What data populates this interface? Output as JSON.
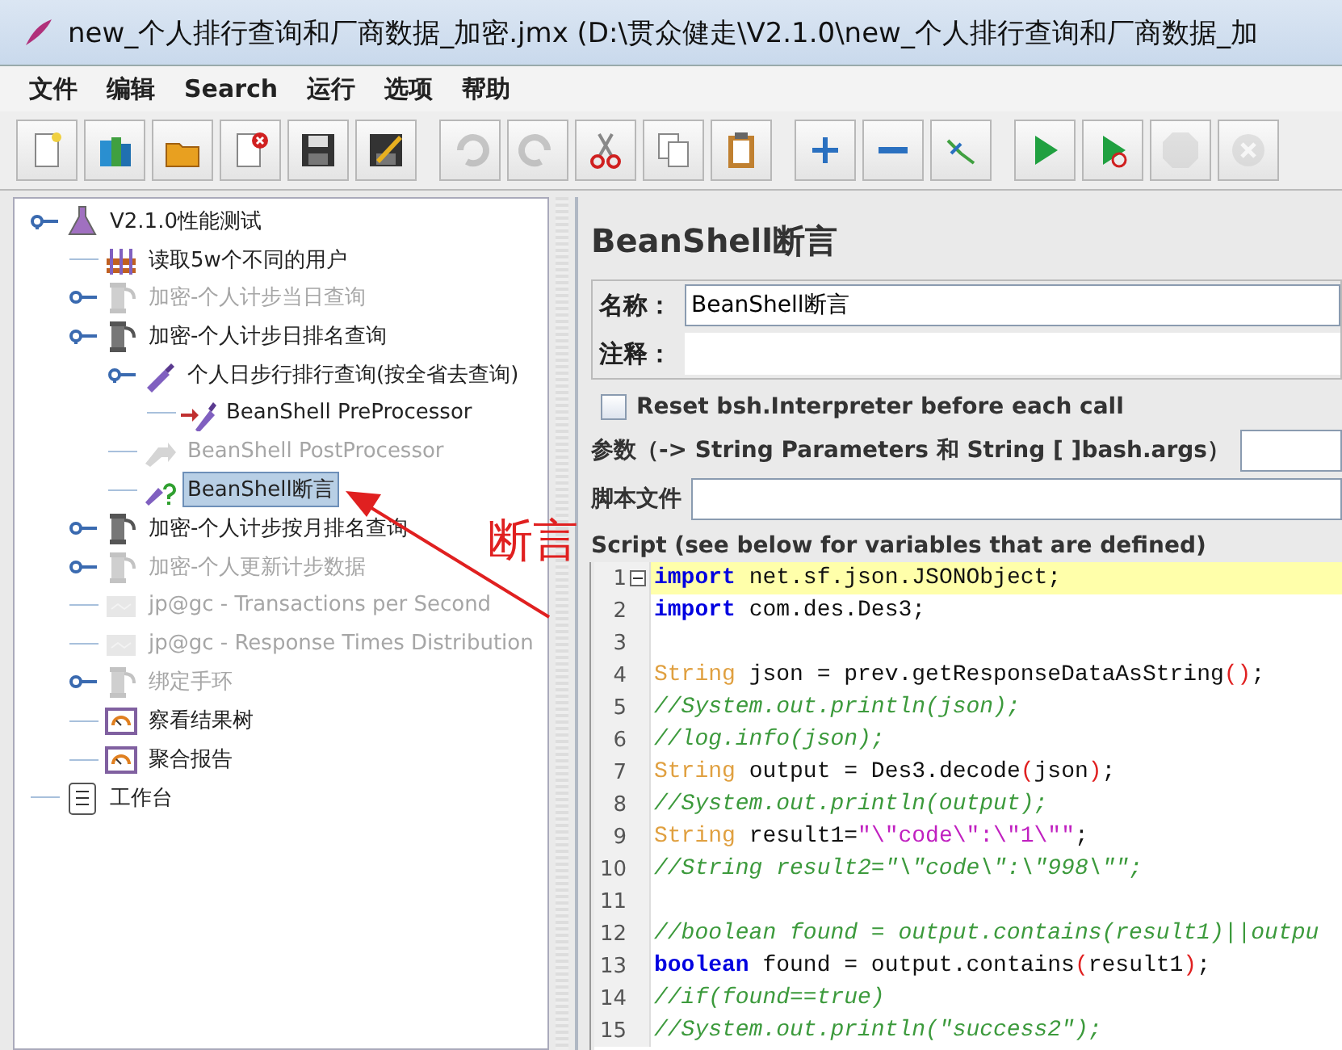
{
  "window": {
    "title": "new_个人排行查询和厂商数据_加密.jmx (D:\\贯众健走\\V2.1.0\\new_个人排行查询和厂商数据_加"
  },
  "menu": [
    "文件",
    "编辑",
    "Search",
    "运行",
    "选项",
    "帮助"
  ],
  "toolbar": [
    [
      {
        "kind": "new",
        "disabled": false
      },
      {
        "kind": "templates",
        "disabled": false
      },
      {
        "kind": "open",
        "disabled": false
      },
      {
        "kind": "close",
        "disabled": false
      },
      {
        "kind": "save",
        "disabled": false
      },
      {
        "kind": "save-as",
        "disabled": false
      }
    ],
    [
      {
        "kind": "undo",
        "disabled": true
      },
      {
        "kind": "redo",
        "disabled": true
      },
      {
        "kind": "cut",
        "disabled": false
      },
      {
        "kind": "copy",
        "disabled": false
      },
      {
        "kind": "paste",
        "disabled": false
      }
    ],
    [
      {
        "kind": "expand",
        "disabled": false
      },
      {
        "kind": "collapse",
        "disabled": false
      },
      {
        "kind": "toggle",
        "disabled": false
      }
    ],
    [
      {
        "kind": "start",
        "disabled": false
      },
      {
        "kind": "start-no-timers",
        "disabled": false
      },
      {
        "kind": "stop",
        "disabled": true
      },
      {
        "kind": "shutdown",
        "disabled": true
      }
    ]
  ],
  "tree": {
    "label": "V2.1.0性能测试",
    "kind": "testplan",
    "disabled": false,
    "selected": false,
    "children": [
      {
        "label": "读取5w个不同的用户",
        "kind": "csv",
        "disabled": false,
        "selected": false
      },
      {
        "label": "加密-个人计步当日查询",
        "kind": "threadgroup",
        "disabled": true,
        "selected": false,
        "collapsed": true
      },
      {
        "label": "加密-个人计步日排名查询",
        "kind": "threadgroup",
        "disabled": false,
        "selected": false,
        "children": [
          {
            "label": "个人日步行排行查询(按全省去查询)",
            "kind": "sampler",
            "disabled": false,
            "selected": false,
            "children": [
              {
                "label": "BeanShell PreProcessor",
                "kind": "preprocessor",
                "disabled": false,
                "selected": false
              }
            ]
          },
          {
            "label": "BeanShell PostProcessor",
            "kind": "postprocessor",
            "disabled": true,
            "selected": false
          },
          {
            "label": "BeanShell断言",
            "kind": "assertion",
            "disabled": false,
            "selected": true
          }
        ]
      },
      {
        "label": "加密-个人计步按月排名查询",
        "kind": "threadgroup",
        "disabled": false,
        "selected": false,
        "collapsed": true
      },
      {
        "label": "加密-个人更新计步数据",
        "kind": "threadgroup",
        "disabled": true,
        "selected": false,
        "collapsed": true
      },
      {
        "label": "jp@gc - Transactions per Second",
        "kind": "graph",
        "disabled": true,
        "selected": false
      },
      {
        "label": "jp@gc - Response Times Distribution",
        "kind": "graph",
        "disabled": true,
        "selected": false
      },
      {
        "label": "绑定手环",
        "kind": "threadgroup",
        "disabled": true,
        "selected": false,
        "collapsed": true
      },
      {
        "label": "察看结果树",
        "kind": "listener",
        "disabled": false,
        "selected": false
      },
      {
        "label": "聚合报告",
        "kind": "listener",
        "disabled": false,
        "selected": false
      }
    ]
  },
  "workbench": {
    "label": "工作台"
  },
  "panel": {
    "title": "BeanShell断言",
    "name_label": "名称：",
    "name_value": "BeanShell断言",
    "comment_label": "注释：",
    "reset_checkbox": {
      "label": "Reset bsh.Interpreter before each call",
      "checked": false
    },
    "params_label": "参数（-> String Parameters 和 String [ ]bash.args）",
    "script_file_label": "脚本文件",
    "script_label": "Script (see below for variables that are defined)"
  },
  "code": [
    {
      "number": "1",
      "current": true,
      "foldable": true,
      "segments": [
        {
          "kind": "keyword",
          "text": "import"
        },
        {
          "kind": "plain",
          "text": " net.sf.json.JSONObject;"
        }
      ]
    },
    {
      "number": "2",
      "current": false,
      "segments": [
        {
          "kind": "keyword",
          "text": "import"
        },
        {
          "kind": "plain",
          "text": " com.des.Des3;"
        }
      ]
    },
    {
      "number": "3",
      "current": false
    },
    {
      "number": "4",
      "current": false,
      "segments": [
        {
          "kind": "type",
          "text": "String"
        },
        {
          "kind": "plain",
          "text": " json = prev.getResponseDataAsString"
        },
        {
          "kind": "paren",
          "text": "()"
        },
        {
          "kind": "plain",
          "text": ";"
        }
      ]
    },
    {
      "number": "5",
      "current": false,
      "segments": [
        {
          "kind": "comment",
          "text": "//System.out.println(json);"
        }
      ]
    },
    {
      "number": "6",
      "current": false,
      "segments": [
        {
          "kind": "comment",
          "text": "//log.info(json);"
        }
      ]
    },
    {
      "number": "7",
      "current": false,
      "segments": [
        {
          "kind": "type",
          "text": "String"
        },
        {
          "kind": "plain",
          "text": " output = Des3.decode"
        },
        {
          "kind": "paren",
          "text": "("
        },
        {
          "kind": "plain",
          "text": "json"
        },
        {
          "kind": "paren",
          "text": ")"
        },
        {
          "kind": "plain",
          "text": ";"
        }
      ]
    },
    {
      "number": "8",
      "current": false,
      "segments": [
        {
          "kind": "comment",
          "text": "//System.out.println(output);"
        }
      ]
    },
    {
      "number": "9",
      "current": false,
      "segments": [
        {
          "kind": "type",
          "text": "String"
        },
        {
          "kind": "plain",
          "text": " result1="
        },
        {
          "kind": "string",
          "text": "\"\\\"code\\\":\\\"1\\\"\""
        },
        {
          "kind": "plain",
          "text": ";"
        }
      ]
    },
    {
      "number": "10",
      "current": false,
      "segments": [
        {
          "kind": "comment",
          "text": "//String result2=\"\\\"code\\\":\\\"998\\\"\";"
        }
      ]
    },
    {
      "number": "11",
      "current": false
    },
    {
      "number": "12",
      "current": false,
      "segments": [
        {
          "kind": "comment",
          "text": "//boolean found = output.contains(result1)||outpu"
        }
      ]
    },
    {
      "number": "13",
      "current": false,
      "segments": [
        {
          "kind": "keyword",
          "text": "boolean"
        },
        {
          "kind": "plain",
          "text": " found = output.contains"
        },
        {
          "kind": "paren",
          "text": "("
        },
        {
          "kind": "plain",
          "text": "result1"
        },
        {
          "kind": "paren",
          "text": ")"
        },
        {
          "kind": "plain",
          "text": ";"
        }
      ]
    },
    {
      "number": "14",
      "current": false,
      "segments": [
        {
          "kind": "comment",
          "text": "//if(found==true)"
        }
      ]
    },
    {
      "number": "15",
      "current": false,
      "segments": [
        {
          "kind": "comment",
          "text": "//System.out.println(\"success2\");"
        }
      ]
    }
  ],
  "annotation": {
    "text": "断言"
  }
}
